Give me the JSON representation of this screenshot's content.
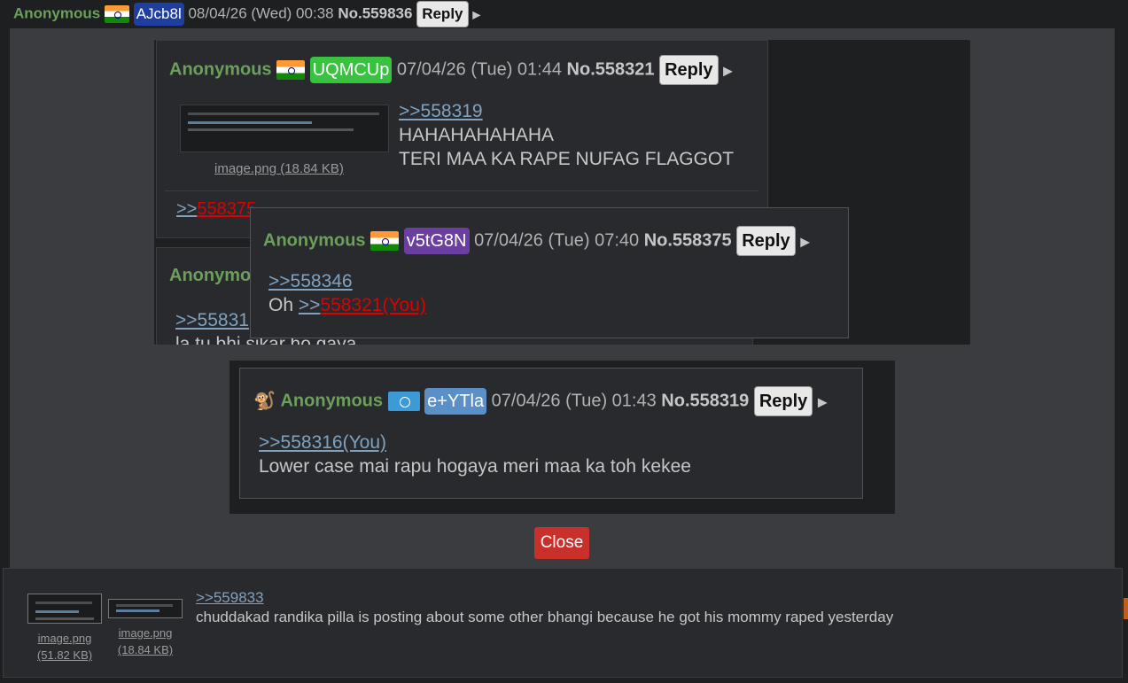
{
  "top_post": {
    "name": "Anonymous",
    "id": "AJcb8l",
    "date": "08/04/26 (Wed) 00:38",
    "no": "No.559836",
    "reply": "Reply",
    "arrow": "▶"
  },
  "post_558321": {
    "name": "Anonymous",
    "id": "UQMCUp",
    "date": "07/04/26 (Tue) 01:44",
    "no": "No.558321",
    "reply": "Reply",
    "arrow": "▶",
    "file": "image.png (18.84 KB)",
    "quote": ">>558319",
    "lines": [
      "HAHAHAHAHAHA",
      "TERI MAA KA RAPE NUFAG FLAGGOT"
    ],
    "backlink_prefix": ">>",
    "backlink": "558375"
  },
  "post_partial": {
    "name": "Anonymous",
    "quote": ">>55831",
    "line": "la tu bhi sikar ho gaya"
  },
  "popup_558375": {
    "name": "Anonymous",
    "id": "v5tG8N",
    "date": "07/04/26 (Tue) 07:40",
    "no": "No.558375",
    "reply": "Reply",
    "arrow": "▶",
    "quote": ">>558346",
    "text_prefix": "Oh ",
    "link_prefix": ">>",
    "link": "558321(You)"
  },
  "post_558319": {
    "name": "Anonymous",
    "id": "e+YTla",
    "date": "07/04/26 (Tue) 01:43",
    "no": "No.558319",
    "reply": "Reply",
    "arrow": "▶",
    "quote": ">>558316(You)",
    "line": "Lower case mai rapu hogaya meri maa ka toh kekee"
  },
  "close_label": "Close",
  "bottom_post": {
    "files": [
      {
        "name": "image.png",
        "size": "(51.82 KB)"
      },
      {
        "name": "image.png",
        "size": "(18.84 KB)"
      }
    ],
    "quote": ">>559833",
    "line": "chuddakad randika pilla is posting about some other bhangi because he got his mommy raped yesterday"
  },
  "colors": {
    "name_green": "#6c9f5b",
    "link_blue": "#81a2be",
    "close_red": "#c9302c",
    "id_AJcb8l": "#1f3fa0",
    "id_UQMCUp": "#39c23f",
    "id_v5tG8N": "#6a3fa0",
    "id_eYTla": "#5a8fc8"
  }
}
